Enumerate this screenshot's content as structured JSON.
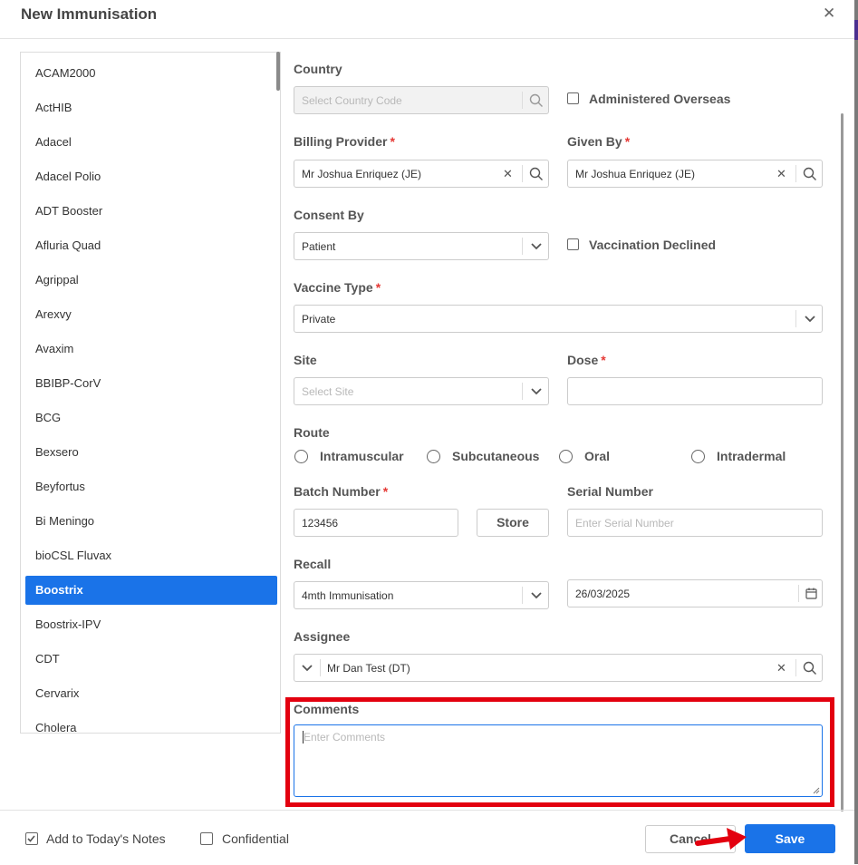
{
  "dialog": {
    "title": "New Immunisation"
  },
  "vaccines": [
    {
      "label": "ACAM2000"
    },
    {
      "label": "ActHIB"
    },
    {
      "label": "Adacel"
    },
    {
      "label": "Adacel Polio"
    },
    {
      "label": "ADT Booster"
    },
    {
      "label": "Afluria Quad"
    },
    {
      "label": "Agrippal"
    },
    {
      "label": "Arexvy"
    },
    {
      "label": "Avaxim"
    },
    {
      "label": "BBIBP-CorV"
    },
    {
      "label": "BCG"
    },
    {
      "label": "Bexsero"
    },
    {
      "label": "Beyfortus"
    },
    {
      "label": "Bi Meningo"
    },
    {
      "label": "bioCSL Fluvax"
    },
    {
      "label": "Boostrix"
    },
    {
      "label": "Boostrix-IPV"
    },
    {
      "label": "CDT"
    },
    {
      "label": "Cervarix"
    },
    {
      "label": "Cholera"
    }
  ],
  "selected_vaccine": "Boostrix",
  "form": {
    "country": {
      "label": "Country",
      "placeholder": "Select Country Code"
    },
    "administered_overseas": {
      "label": "Administered Overseas",
      "checked": false
    },
    "billing_provider": {
      "label": "Billing Provider",
      "required_mark": "*",
      "value": "Mr Joshua Enriquez (JE)"
    },
    "given_by": {
      "label": "Given By",
      "required_mark": "*",
      "value": "Mr Joshua Enriquez (JE)"
    },
    "consent_by": {
      "label": "Consent By",
      "value": "Patient"
    },
    "vaccination_declined": {
      "label": "Vaccination Declined",
      "checked": false
    },
    "vaccine_type": {
      "label": "Vaccine Type",
      "required_mark": "*",
      "value": "Private"
    },
    "site": {
      "label": "Site",
      "placeholder": "Select Site"
    },
    "dose": {
      "label": "Dose",
      "required_mark": "*",
      "value": ""
    },
    "route": {
      "label": "Route",
      "options": [
        {
          "label": "Intramuscular"
        },
        {
          "label": "Subcutaneous"
        },
        {
          "label": "Oral"
        },
        {
          "label": "Intradermal"
        }
      ]
    },
    "batch_number": {
      "label": "Batch Number",
      "required_mark": "*",
      "value": "123456"
    },
    "store_button": "Store",
    "serial_number": {
      "label": "Serial Number",
      "placeholder": "Enter Serial Number"
    },
    "recall": {
      "label": "Recall",
      "value": "4mth Immunisation",
      "date": "26/03/2025"
    },
    "assignee": {
      "label": "Assignee",
      "value": "Mr Dan Test (DT)"
    },
    "comments": {
      "label": "Comments",
      "placeholder": "Enter Comments"
    }
  },
  "footer": {
    "add_to_notes": {
      "label": "Add to Today's Notes",
      "checked": true
    },
    "confidential": {
      "label": "Confidential",
      "checked": false
    },
    "cancel": "Cancel",
    "save": "Save"
  },
  "colors": {
    "accent": "#1a73e8",
    "required": "#e53935",
    "highlight": "#e3000f"
  }
}
